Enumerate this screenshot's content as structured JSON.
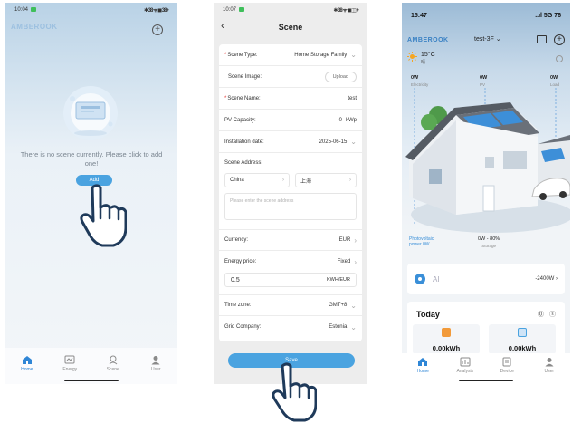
{
  "phone1": {
    "status": {
      "time": "10:04",
      "icons": "✱ ᐧ ᐧ ▮ 38 ▭ ",
      "battery": "",
      "right": "✱ 38 ᯤ ◼ 38+"
    },
    "brand": "AMBEROOK",
    "empty_text": "There is no scene currently. Please click to add one!",
    "add_button": "Add",
    "tabs": [
      {
        "label": "Home",
        "icon": "home-icon",
        "active": true
      },
      {
        "label": "Energy",
        "icon": "energy-icon",
        "active": false
      },
      {
        "label": "Scene",
        "icon": "scene-icon",
        "active": false
      },
      {
        "label": "User",
        "icon": "user-icon",
        "active": false
      }
    ]
  },
  "phone2": {
    "status": {
      "time": "10:07",
      "right": "✱ 38 ᯤ ◼ ◫ +"
    },
    "title": "Scene",
    "fields": {
      "scene_type": {
        "label": "Scene Type:",
        "value": "Home Storage Family"
      },
      "scene_image": {
        "label": "Scene Image:",
        "button": "Upload"
      },
      "scene_name": {
        "label": "Scene Name:",
        "value": "test"
      },
      "pv_capacity": {
        "label": "PV-Capacity:",
        "value": "0",
        "unit": "kWp"
      },
      "installation_date": {
        "label": "Installation date:",
        "value": "2025-06-15"
      },
      "scene_address": {
        "label": "Scene Address:"
      },
      "country": "China",
      "city": "上海",
      "address_placeholder": "Please enter the scene address",
      "currency": {
        "label": "Currency:",
        "value": "EUR"
      },
      "energy_price": {
        "label": "Energy price:",
        "value": "Fixed"
      },
      "price_value": "0.5",
      "price_unit": "KWH/EUR",
      "time_zone": {
        "label": "Time zone:",
        "value": "GMT+8"
      },
      "grid_company": {
        "label": "Grid Company:",
        "value": "Estonia"
      }
    },
    "save_button": "Save"
  },
  "phone3": {
    "status": {
      "time": "15:47",
      "right": "..ıl 5G 76"
    },
    "brand": "AMBEROOK",
    "site": "test-3F",
    "weather": {
      "temp": "15°C",
      "cond": "晴"
    },
    "flows": [
      {
        "value": "0W",
        "label": "Electricity"
      },
      {
        "value": "0W",
        "label": "PV"
      },
      {
        "value": "0W",
        "label": "Load"
      }
    ],
    "pv_label": "Photovoltaic power 0W",
    "battery": {
      "value": "0W - 80%",
      "label": "Storage"
    },
    "ai": {
      "label": "AI",
      "value": "-2400W"
    },
    "today": {
      "title": "Today",
      "icons": "⓪ ⓢ",
      "stats": [
        {
          "value": "0.00kWh",
          "icon": "solar-generation-icon",
          "color": "#f29a3a"
        },
        {
          "value": "0.00kWh",
          "icon": "consumption-icon",
          "color": "#4aa3e0"
        }
      ]
    },
    "tabs": [
      {
        "label": "Home",
        "icon": "home-icon",
        "active": true
      },
      {
        "label": "Analysis",
        "icon": "analysis-icon",
        "active": false
      },
      {
        "label": "Device",
        "icon": "device-icon",
        "active": false
      },
      {
        "label": "User",
        "icon": "user-icon",
        "active": false
      }
    ]
  }
}
